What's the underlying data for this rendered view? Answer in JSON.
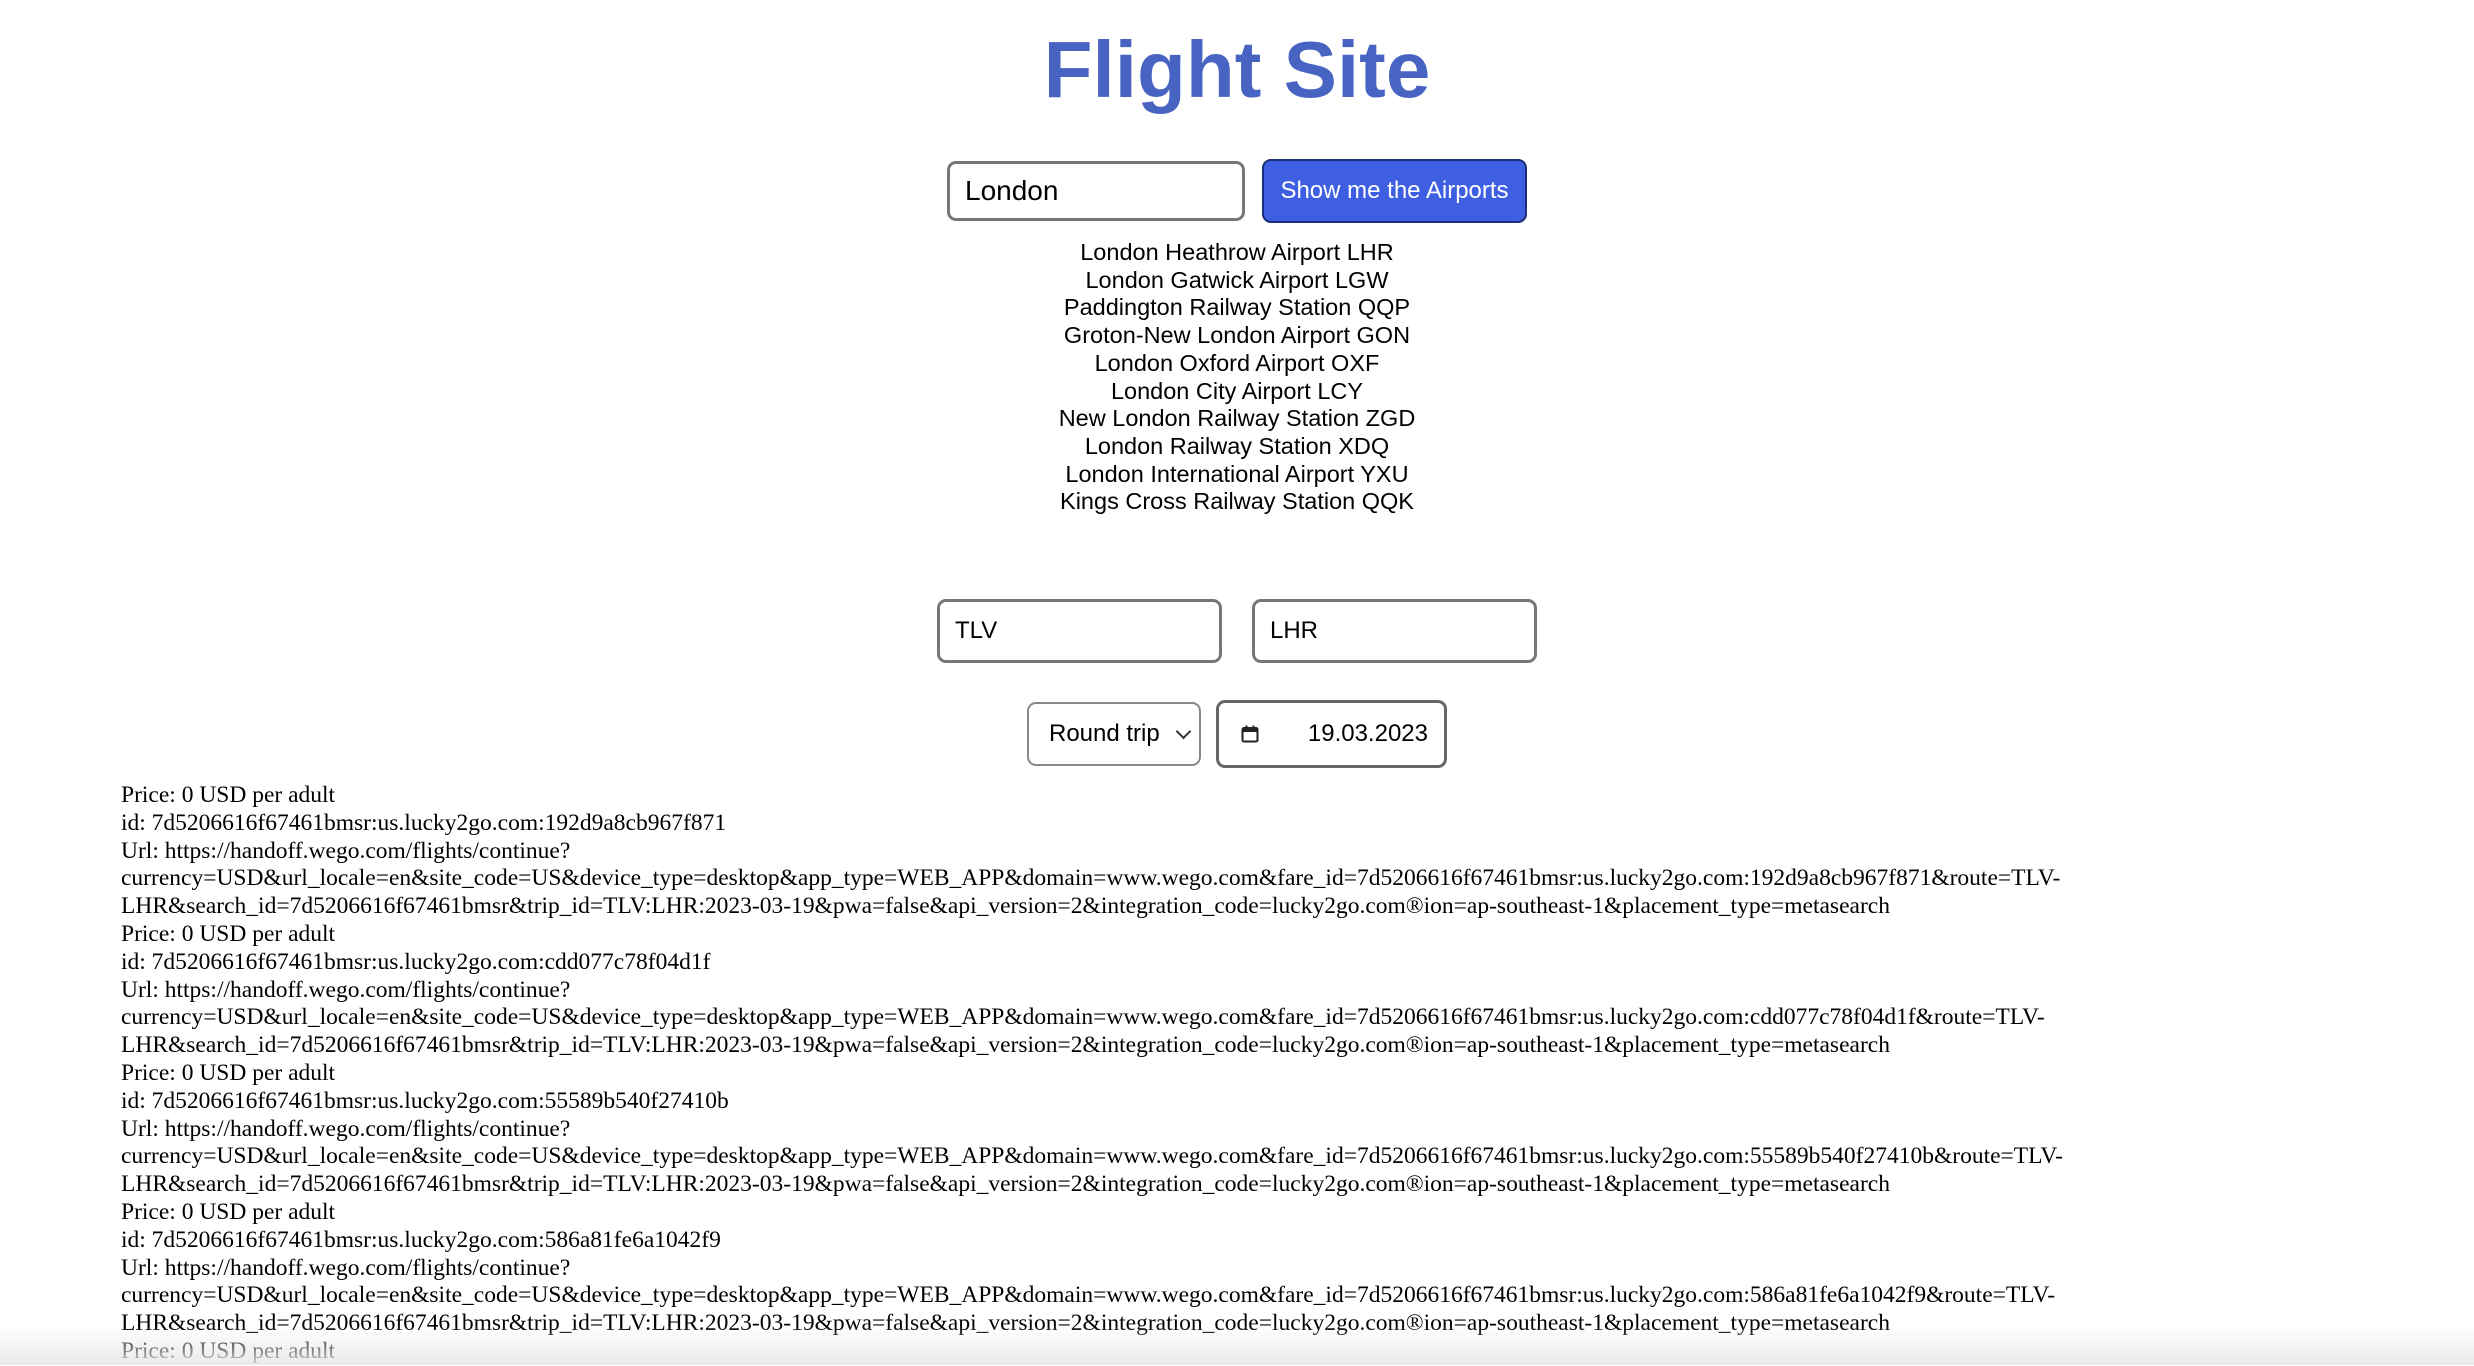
{
  "page": {
    "title": "Flight Site",
    "title_color": "#4764c3",
    "accent_button_color": "#3f5fe3"
  },
  "search": {
    "city_value": "London",
    "button_label": "Show me the Airports"
  },
  "airports": [
    "London Heathrow Airport LHR",
    "London Gatwick Airport LGW",
    "Paddington Railway Station QQP",
    "Groton-New London Airport GON",
    "London Oxford Airport OXF",
    "London City Airport LCY",
    "New London Railway Station ZGD",
    "London Railway Station XDQ",
    "London International Airport YXU",
    "Kings Cross Railway Station QQK"
  ],
  "route": {
    "origin": "TLV",
    "destination": "LHR"
  },
  "trip": {
    "type_selected": "Round trip",
    "date": "19.03.2023",
    "calendar_icon": "calendar-icon"
  },
  "results": [
    {
      "price": "Price: 0 USD per adult",
      "id": "id: 7d5206616f67461bmsr:us.lucky2go.com:192d9a8cb967f871",
      "url_line1": "Url: https://handoff.wego.com/flights/continue?",
      "url_line2": "currency=USD&url_locale=en&site_code=US&device_type=desktop&app_type=WEB_APP&domain=www.wego.com&fare_id=7d5206616f67461bmsr:us.lucky2go.com:192d9a8cb967f871&route=TLV-",
      "url_line3": "LHR&search_id=7d5206616f67461bmsr&trip_id=TLV:LHR:2023-03-19&pwa=false&api_version=2&integration_code=lucky2go.com®ion=ap-southeast-1&placement_type=metasearch"
    },
    {
      "price": "Price: 0 USD per adult",
      "id": "id: 7d5206616f67461bmsr:us.lucky2go.com:cdd077c78f04d1f",
      "url_line1": "Url: https://handoff.wego.com/flights/continue?",
      "url_line2": "currency=USD&url_locale=en&site_code=US&device_type=desktop&app_type=WEB_APP&domain=www.wego.com&fare_id=7d5206616f67461bmsr:us.lucky2go.com:cdd077c78f04d1f&route=TLV-",
      "url_line3": "LHR&search_id=7d5206616f67461bmsr&trip_id=TLV:LHR:2023-03-19&pwa=false&api_version=2&integration_code=lucky2go.com®ion=ap-southeast-1&placement_type=metasearch"
    },
    {
      "price": "Price: 0 USD per adult",
      "id": "id: 7d5206616f67461bmsr:us.lucky2go.com:55589b540f27410b",
      "url_line1": "Url: https://handoff.wego.com/flights/continue?",
      "url_line2": "currency=USD&url_locale=en&site_code=US&device_type=desktop&app_type=WEB_APP&domain=www.wego.com&fare_id=7d5206616f67461bmsr:us.lucky2go.com:55589b540f27410b&route=TLV-",
      "url_line3": "LHR&search_id=7d5206616f67461bmsr&trip_id=TLV:LHR:2023-03-19&pwa=false&api_version=2&integration_code=lucky2go.com®ion=ap-southeast-1&placement_type=metasearch"
    },
    {
      "price": "Price: 0 USD per adult",
      "id": "id: 7d5206616f67461bmsr:us.lucky2go.com:586a81fe6a1042f9",
      "url_line1": "Url: https://handoff.wego.com/flights/continue?",
      "url_line2": "currency=USD&url_locale=en&site_code=US&device_type=desktop&app_type=WEB_APP&domain=www.wego.com&fare_id=7d5206616f67461bmsr:us.lucky2go.com:586a81fe6a1042f9&route=TLV-",
      "url_line3": "LHR&search_id=7d5206616f67461bmsr&trip_id=TLV:LHR:2023-03-19&pwa=false&api_version=2&integration_code=lucky2go.com®ion=ap-southeast-1&placement_type=metasearch"
    },
    {
      "price": "Price: 0 USD per adult"
    }
  ]
}
